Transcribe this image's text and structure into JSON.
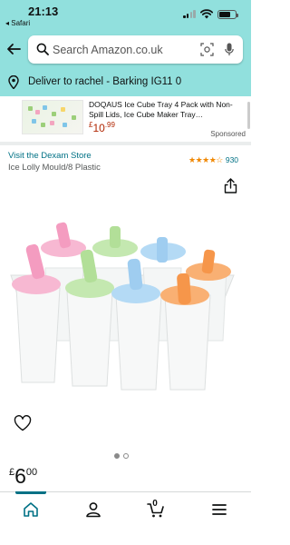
{
  "status_bar": {
    "time": "21:13",
    "back_app": "◂ Safari"
  },
  "header": {
    "search_placeholder": "Search Amazon.co.uk",
    "deliver_to": "Deliver to rachel - Barking IG11 0"
  },
  "sponsored_ad": {
    "title": "DOQAUS Ice Cube Tray 4 Pack with Non-Spill Lids, Ice Cube Maker Tray…",
    "price_symbol": "£",
    "price_whole": "10",
    "price_fraction": ".99",
    "sponsored_label": "Sponsored"
  },
  "product": {
    "store_link": "Visit the Dexam Store",
    "rating_stars": "★★★★☆",
    "rating_value": 4.5,
    "rating_count": "930",
    "title": "Ice Lolly Mould/8 Plastic",
    "image_count": 2,
    "active_image": 1,
    "price_symbol": "£",
    "price_whole": "6",
    "price_fraction": "00"
  },
  "bottom_nav": {
    "items": [
      "home-icon",
      "account-icon",
      "cart-icon",
      "menu-icon"
    ],
    "cart_count": "0",
    "active": "home-icon"
  },
  "colors": {
    "header_bg": "#91e0dd",
    "link": "#007185",
    "price_red": "#b12704",
    "star": "#f08804"
  }
}
